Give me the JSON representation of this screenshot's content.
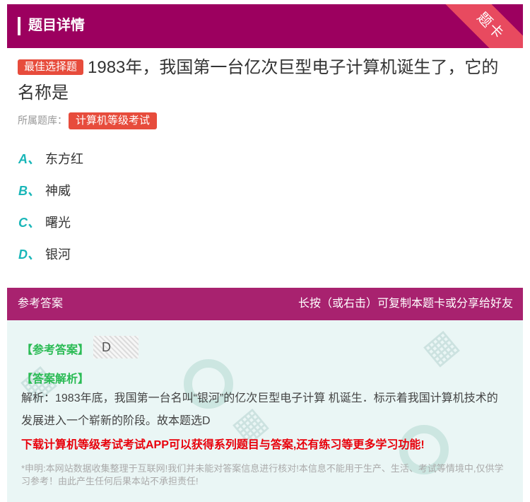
{
  "header": {
    "title": "题目详情",
    "corner_badge": "题卡"
  },
  "question": {
    "type_tag": "最佳选择题",
    "text": "1983年，我国第一台亿次巨型电子计算机诞生了，它的名称是",
    "source_label": "所属题库：",
    "source_tag": "计算机等级考试"
  },
  "options": [
    {
      "letter": "A、",
      "text": "东方红"
    },
    {
      "letter": "B、",
      "text": "神威"
    },
    {
      "letter": "C、",
      "text": "曙光"
    },
    {
      "letter": "D、",
      "text": "银河"
    }
  ],
  "answer_section": {
    "title": "参考答案",
    "share_hint": "长按（或右击）可复制本题卡或分享给好友",
    "answer_label": "【参考答案】",
    "answer_value": "D",
    "analysis_label": "【答案解析】",
    "analysis_text": "解析：1983年底，我国第一台名叫“银河”的亿次巨型电子计算 机诞生．标示着我国计算机技术的发展进入一个崭新的阶段。故本题选D",
    "download_text": "下载计算机等级考试考试APP可以获得系列题目与答案,还有练习等更多学习功能!",
    "notice": "*申明:本网站数据收集整理于互联网!我们并未能对答案信息进行核对!本信息不能用于生产、生活、考试等情境中,仅供学习参考！由此产生任何后果本站不承担责任!"
  },
  "colors": {
    "header": "#9c005f",
    "accent_red": "#e74c3c",
    "option_letter": "#19b6b8",
    "answer_green": "#2bbb55"
  }
}
